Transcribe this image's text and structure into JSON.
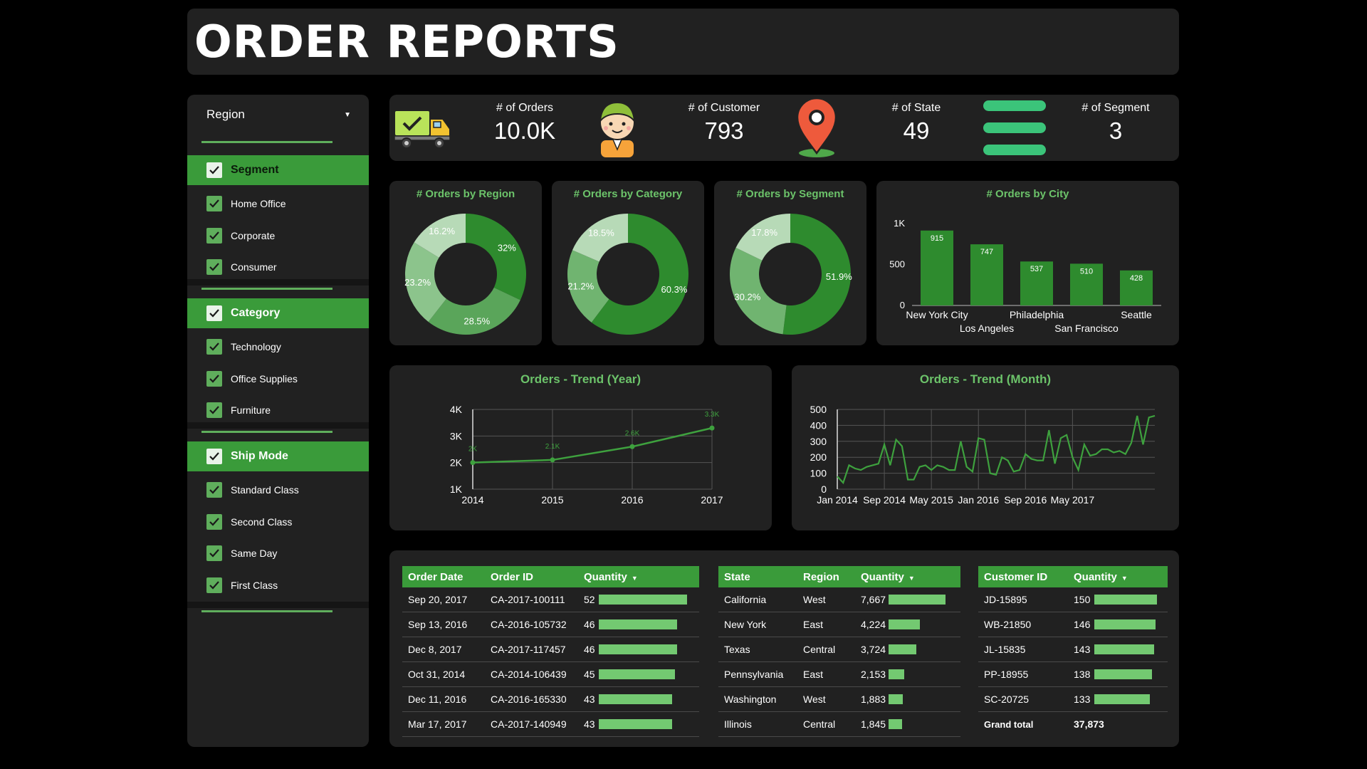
{
  "header": {
    "title": "ORDER REPORTS"
  },
  "sidebar": {
    "region_label": "Region",
    "groups": [
      {
        "label": "Segment",
        "items": [
          "Home Office",
          "Corporate",
          "Consumer"
        ]
      },
      {
        "label": "Category",
        "items": [
          "Technology",
          "Office Supplies",
          "Furniture"
        ]
      },
      {
        "label": "Ship Mode",
        "items": [
          "Standard Class",
          "Second Class",
          "Same Day",
          "First Class"
        ]
      }
    ]
  },
  "kpis": [
    {
      "label": "# of Orders",
      "value": "10.0K",
      "icon": "truck-icon"
    },
    {
      "label": "# of Customer",
      "value": "793",
      "icon": "customer-avatar-icon"
    },
    {
      "label": "# of State",
      "value": "49",
      "icon": "map-pin-icon"
    },
    {
      "label": "# of Segment",
      "value": "3",
      "icon": "stacked-bars-icon"
    }
  ],
  "colors": {
    "accent": "#3a9b3a",
    "accent_light": "#73c971",
    "title_green": "#6cc36a",
    "panel": "#212121",
    "background": "#000000"
  },
  "chart_data": [
    {
      "type": "pie",
      "title": "# Orders by Region",
      "labels": [
        "32%",
        "28.5%",
        "23.2%",
        "16.2%"
      ],
      "values": [
        32,
        28.5,
        23.2,
        16.2
      ],
      "colors": [
        "#2e8b2e",
        "#5aa55a",
        "#8cc48c",
        "#b7dab7"
      ]
    },
    {
      "type": "pie",
      "title": "# Orders by Category",
      "labels": [
        "60.3%",
        "21.2%",
        "18.5%"
      ],
      "values": [
        60.3,
        21.2,
        18.5
      ],
      "colors": [
        "#2e8b2e",
        "#70b470",
        "#b7dab7"
      ]
    },
    {
      "type": "pie",
      "title": "# Orders by Segment",
      "labels": [
        "51.9%",
        "30.2%",
        "17.8%"
      ],
      "values": [
        51.9,
        30.2,
        17.8
      ],
      "colors": [
        "#2e8b2e",
        "#70b470",
        "#b7dab7"
      ]
    },
    {
      "type": "bar",
      "title": "# Orders by City",
      "categories": [
        "New York City",
        "Los Angeles",
        "Philadelphia",
        "San Francisco",
        "Seattle"
      ],
      "values": [
        915,
        747,
        537,
        510,
        428
      ],
      "yticks": [
        "0",
        "500",
        "1K"
      ],
      "ylim": [
        0,
        1000
      ]
    },
    {
      "type": "line",
      "title": "Orders - Trend (Year)",
      "x": [
        "2014",
        "2015",
        "2016",
        "2017"
      ],
      "y": [
        2.0,
        2.1,
        2.6,
        3.3
      ],
      "point_labels": [
        "2K",
        "2.1K",
        "2.6K",
        "3.3K"
      ],
      "yticks": [
        "1K",
        "2K",
        "3K",
        "4K"
      ],
      "ylim": [
        1,
        4
      ],
      "grid": true
    },
    {
      "type": "line",
      "title": "Orders - Trend (Month)",
      "xticks": [
        "Jan 2014",
        "Sep 2014",
        "May 2015",
        "Jan 2016",
        "Sep 2016",
        "May 2017"
      ],
      "y": [
        80,
        40,
        150,
        130,
        120,
        140,
        150,
        160,
        280,
        150,
        310,
        270,
        60,
        60,
        140,
        150,
        120,
        150,
        140,
        120,
        120,
        300,
        140,
        110,
        320,
        310,
        100,
        90,
        200,
        180,
        110,
        120,
        220,
        190,
        180,
        180,
        370,
        160,
        320,
        340,
        200,
        120,
        280,
        210,
        220,
        250,
        250,
        230,
        240,
        220,
        290,
        460,
        280,
        450,
        460
      ],
      "yticks": [
        "0",
        "100",
        "200",
        "300",
        "400",
        "500"
      ],
      "ylim": [
        0,
        500
      ],
      "grid": true
    }
  ],
  "tables": {
    "orders": {
      "columns": [
        "Order Date",
        "Order ID",
        "Quantity"
      ],
      "rows": [
        {
          "date": "Sep 20, 2017",
          "id": "CA-2017-100111",
          "qty": 52
        },
        {
          "date": "Sep 13, 2016",
          "id": "CA-2016-105732",
          "qty": 46
        },
        {
          "date": "Dec 8, 2017",
          "id": "CA-2017-117457",
          "qty": 46
        },
        {
          "date": "Oct 31, 2014",
          "id": "CA-2014-106439",
          "qty": 45
        },
        {
          "date": "Dec 11, 2016",
          "id": "CA-2016-165330",
          "qty": 43
        },
        {
          "date": "Mar 17, 2017",
          "id": "CA-2017-140949",
          "qty": 43
        }
      ]
    },
    "states": {
      "columns": [
        "State",
        "Region",
        "Quantity"
      ],
      "rows": [
        {
          "state": "California",
          "region": "West",
          "qty": "7,667",
          "val": 7667
        },
        {
          "state": "New York",
          "region": "East",
          "qty": "4,224",
          "val": 4224
        },
        {
          "state": "Texas",
          "region": "Central",
          "qty": "3,724",
          "val": 3724
        },
        {
          "state": "Pennsylvania",
          "region": "East",
          "qty": "2,153",
          "val": 2153
        },
        {
          "state": "Washington",
          "region": "West",
          "qty": "1,883",
          "val": 1883
        },
        {
          "state": "Illinois",
          "region": "Central",
          "qty": "1,845",
          "val": 1845
        }
      ]
    },
    "customers": {
      "columns": [
        "Customer ID",
        "Quantity"
      ],
      "rows": [
        {
          "id": "JD-15895",
          "qty": 150
        },
        {
          "id": "WB-21850",
          "qty": 146
        },
        {
          "id": "JL-15835",
          "qty": 143
        },
        {
          "id": "PP-18955",
          "qty": 138
        },
        {
          "id": "SC-20725",
          "qty": 133
        }
      ],
      "grand_total_label": "Grand total",
      "grand_total_value": "37,873"
    }
  }
}
